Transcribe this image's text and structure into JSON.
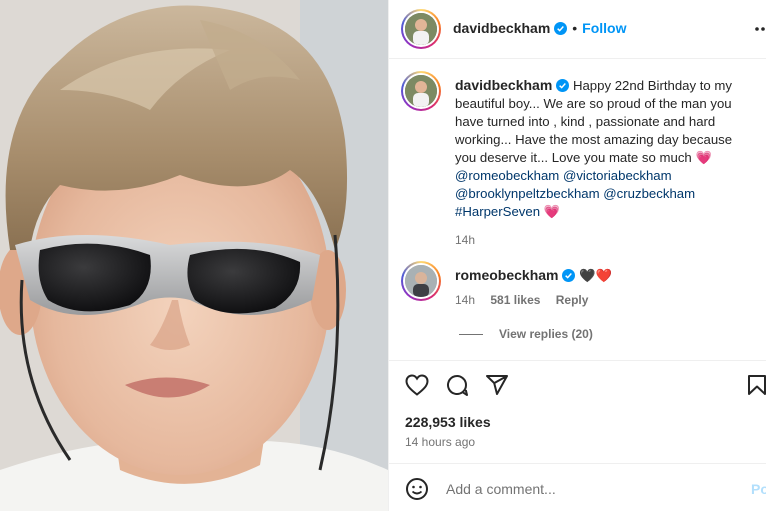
{
  "header": {
    "username": "davidbeckham",
    "separator": "•",
    "follow_label": "Follow",
    "more_label": "..."
  },
  "caption": {
    "username": "davidbeckham",
    "text": "Happy 22nd Birthday to my beautiful boy... We are so proud of the man you have turned into , kind , passionate and hard working... Have the most amazing day because you deserve it... Love you mate so much",
    "emoji_1": "💗",
    "mentions": [
      "@romeobeckham",
      "@victoriabeckham",
      "@brooklynpeltzbeckham",
      "@cruzbeckham"
    ],
    "hashtag": "#HarperSeven",
    "emoji_2": "💗",
    "time": "14h"
  },
  "comment": {
    "username": "romeobeckham",
    "emoji": "🖤❤️",
    "time": "14h",
    "likes": "581 likes",
    "reply_label": "Reply",
    "view_replies": "View replies (20)"
  },
  "post_stats": {
    "likes": "228,953 likes",
    "time_ago": "14 hours ago"
  },
  "add_comment": {
    "placeholder": "Add a comment...",
    "post_label": "Post"
  },
  "colors": {
    "accent": "#0095f6",
    "mention": "#00376b",
    "secondary_text": "#737373"
  },
  "icons": {
    "verified": "verified-badge-icon",
    "like": "heart-icon",
    "comment": "comment-bubble-icon",
    "share": "paper-plane-icon",
    "save": "bookmark-icon",
    "emoji": "smiley-icon",
    "more": "more-horizontal-icon"
  }
}
